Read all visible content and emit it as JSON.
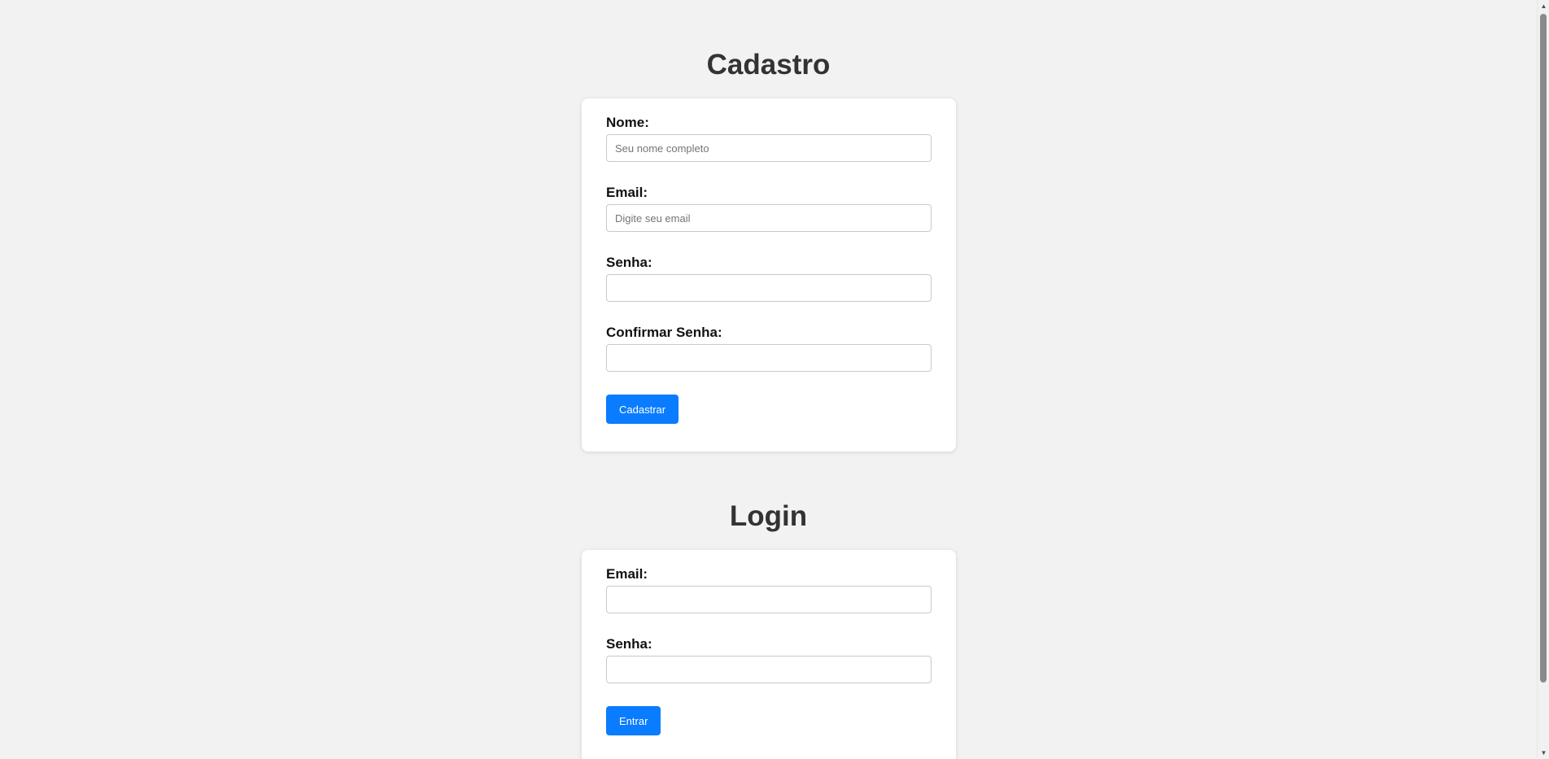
{
  "register": {
    "title": "Cadastro",
    "name_label": "Nome:",
    "name_placeholder": "Seu nome completo",
    "name_value": "",
    "email_label": "Email:",
    "email_placeholder": "Digite seu email",
    "email_value": "",
    "password_label": "Senha:",
    "password_value": "",
    "confirm_label": "Confirmar Senha:",
    "confirm_value": "",
    "submit_label": "Cadastrar"
  },
  "login": {
    "title": "Login",
    "email_label": "Email:",
    "email_value": "",
    "password_label": "Senha:",
    "password_value": "",
    "submit_label": "Entrar"
  },
  "scrollbar": {
    "up_icon": "▲",
    "down_icon": "▼"
  },
  "colors": {
    "background": "#f2f2f2",
    "card": "#ffffff",
    "accent": "#0a7cff",
    "title": "#333333"
  }
}
